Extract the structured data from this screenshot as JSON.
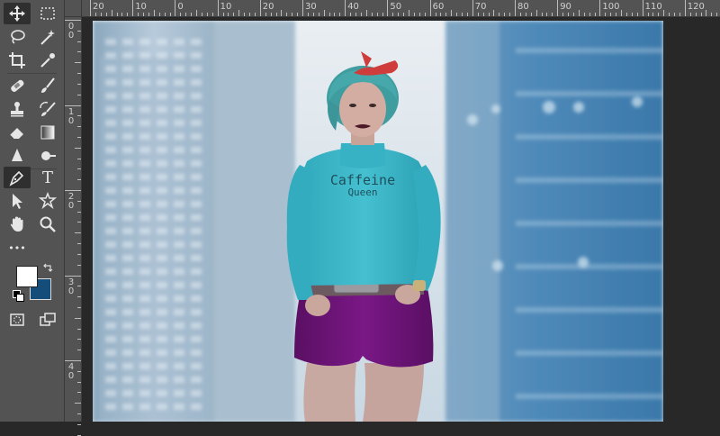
{
  "toolbar": {
    "tools": [
      {
        "name": "move-tool",
        "icon": "move-icon"
      },
      {
        "name": "marquee-tool",
        "icon": "rect-marquee-icon"
      },
      {
        "name": "lasso-tool",
        "icon": "lasso-icon"
      },
      {
        "name": "magic-wand-tool",
        "icon": "magic-wand-icon"
      },
      {
        "name": "crop-tool",
        "icon": "crop-icon"
      },
      {
        "name": "eyedropper-tool",
        "icon": "eyedropper-icon"
      },
      {
        "name": "healing-brush-tool",
        "icon": "bandage-icon"
      },
      {
        "name": "brush-tool",
        "icon": "brush-icon"
      },
      {
        "name": "clone-stamp-tool",
        "icon": "stamp-icon"
      },
      {
        "name": "history-brush-tool",
        "icon": "history-brush-icon"
      },
      {
        "name": "eraser-tool",
        "icon": "eraser-icon"
      },
      {
        "name": "gradient-tool",
        "icon": "gradient-icon"
      },
      {
        "name": "blur-tool",
        "icon": "blur-drop-icon"
      },
      {
        "name": "dodge-tool",
        "icon": "dodge-icon"
      },
      {
        "name": "pen-tool",
        "icon": "pen-icon"
      },
      {
        "name": "type-tool",
        "icon": "type-icon",
        "glyph": "T"
      },
      {
        "name": "path-selection-tool",
        "icon": "arrow-icon"
      },
      {
        "name": "custom-shape-tool",
        "icon": "shape-icon"
      },
      {
        "name": "hand-tool",
        "icon": "hand-icon"
      },
      {
        "name": "zoom-tool",
        "icon": "zoom-icon"
      },
      {
        "name": "edit-toolbar",
        "icon": "more-icon",
        "glyph": "•••"
      }
    ],
    "foreground_color": "#ffffff",
    "background_color": "#154d7a",
    "quick_mask_icon": "quick-mask-icon",
    "screen_mode_icon": "screen-mode-icon",
    "swap_icon": "swap-colors-icon",
    "default_colors_icon": "default-colors-icon"
  },
  "ruler": {
    "horizontal_labels": [
      "20",
      "10",
      "0",
      "10",
      "20",
      "30",
      "40",
      "50",
      "60",
      "70",
      "80",
      "90",
      "100",
      "110",
      "120"
    ],
    "vertical_labels": [
      "0",
      "1",
      "2",
      "3",
      "4"
    ]
  },
  "photo": {
    "shirt_text_line1": "Caffeine",
    "shirt_text_line2": "Queen",
    "colors": {
      "sky": "#dfe7ee",
      "shirt": "#3fb8c9",
      "shorts": "#6b1475",
      "hair": "#45a3a6",
      "bandana": "#d23a3a"
    }
  }
}
